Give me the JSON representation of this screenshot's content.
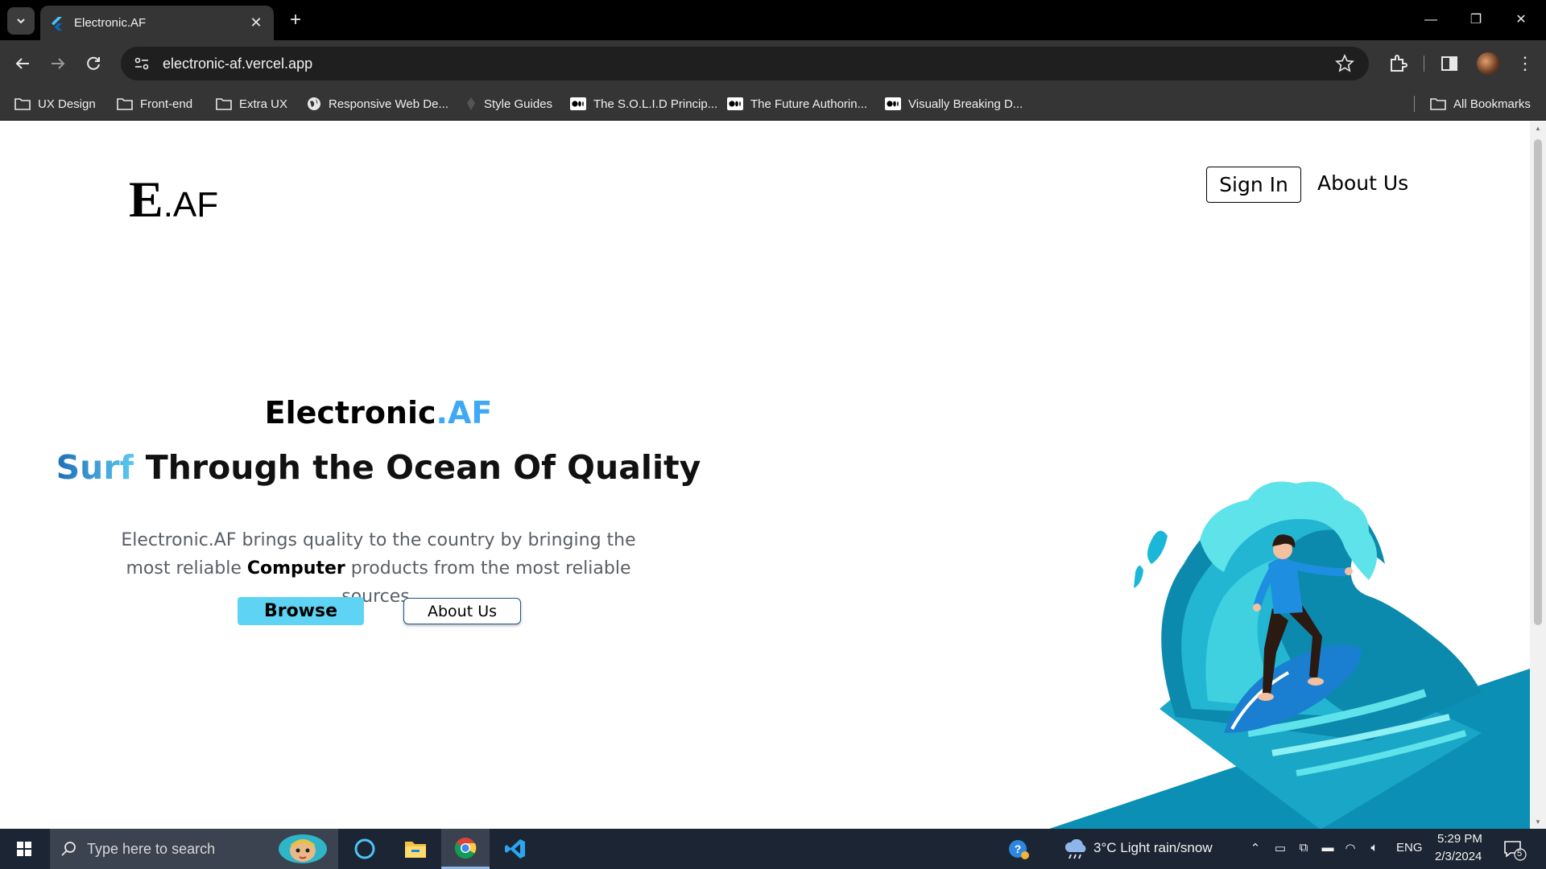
{
  "browser": {
    "tab_title": "Electronic.AF",
    "url": "electronic-af.vercel.app",
    "bookmarks": [
      {
        "label": "UX Design",
        "icon": "folder-icon"
      },
      {
        "label": "Front-end",
        "icon": "folder-icon"
      },
      {
        "label": "Extra UX",
        "icon": "folder-icon"
      },
      {
        "label": "Responsive Web De...",
        "icon": "globe-icon"
      },
      {
        "label": "Style Guides",
        "icon": "pen-nib-icon"
      },
      {
        "label": "The S.O.L.I.D Princip...",
        "icon": "medium-icon"
      },
      {
        "label": "The Future Authorin...",
        "icon": "medium-icon"
      },
      {
        "label": "Visually Breaking D...",
        "icon": "medium-icon"
      },
      {
        "label": "All Bookmarks",
        "icon": "folder-icon"
      }
    ]
  },
  "site": {
    "logo_big": "E",
    "logo_small": ".AF",
    "nav": {
      "sign_in": "Sign In",
      "about": "About Us"
    },
    "hero": {
      "brand_main": "Electronic",
      "brand_accent": ".AF",
      "tagline_accent": "Surf",
      "tagline_rest": " Through the Ocean Of Quality",
      "desc_part1": "Electronic.AF brings quality to the country by bringing the most reliable ",
      "desc_bold": "Computer",
      "desc_part2": " products from the most reliable sources.",
      "browse_label": "Browse",
      "about_label": "About Us"
    }
  },
  "taskbar": {
    "search_placeholder": "Type here to search",
    "weather": "3°C  Light rain/snow",
    "language": "ENG",
    "time": "5:29 PM",
    "date": "2/3/2024",
    "notifications": "5"
  },
  "colors": {
    "accent": "#3fa9f5",
    "browse_button": "#5fd3f3",
    "wave_dark": "#0b8fb5",
    "wave_light": "#5ee3ea"
  }
}
